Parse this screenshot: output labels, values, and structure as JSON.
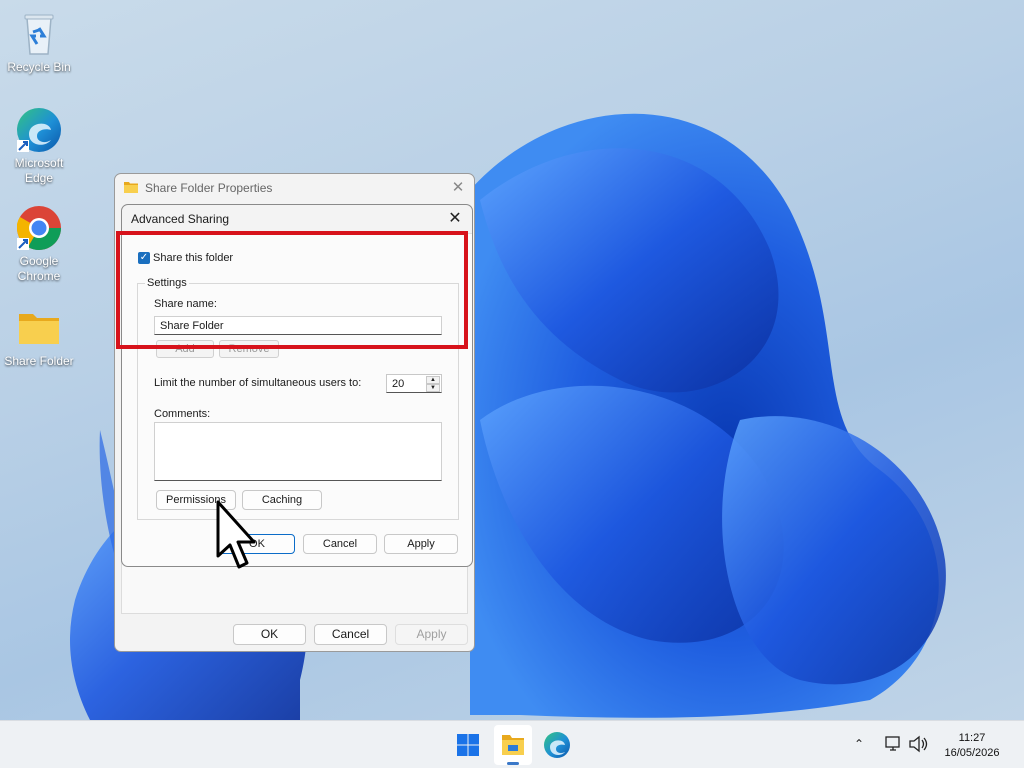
{
  "desktop": {
    "icons": [
      {
        "label": "Recycle Bin",
        "icon": "recycle-bin-icon"
      },
      {
        "label": "Microsoft Edge",
        "icon": "edge-icon"
      },
      {
        "label": "Google Chrome",
        "icon": "chrome-icon"
      },
      {
        "label": "Share Folder",
        "icon": "folder-icon"
      }
    ]
  },
  "properties_window": {
    "title": "Share Folder Properties",
    "close_icon": "close-icon",
    "buttons": {
      "ok": "OK",
      "cancel": "Cancel",
      "apply": "Apply"
    }
  },
  "advanced_sharing": {
    "title": "Advanced Sharing",
    "share_checkbox": {
      "label": "Share this folder",
      "checked": true
    },
    "settings": {
      "legend": "Settings",
      "share_name_label": "Share name:",
      "share_name_value": "Share Folder",
      "add_label": "Add",
      "remove_label": "Remove",
      "limit_label": "Limit the number of simultaneous users to:",
      "limit_value": "20",
      "comments_label": "Comments:",
      "comments_value": "",
      "permissions_label": "Permissions",
      "caching_label": "Caching"
    },
    "buttons": {
      "ok": "OK",
      "cancel": "Cancel",
      "apply": "Apply"
    }
  },
  "taskbar": {
    "icons": [
      "windows-start-icon",
      "file-explorer-icon",
      "edge-icon"
    ],
    "tray": {
      "time": "11:27",
      "date": "16/05/2026"
    }
  },
  "colors": {
    "highlight": "#d7121b",
    "accent": "#1a6fbf"
  }
}
